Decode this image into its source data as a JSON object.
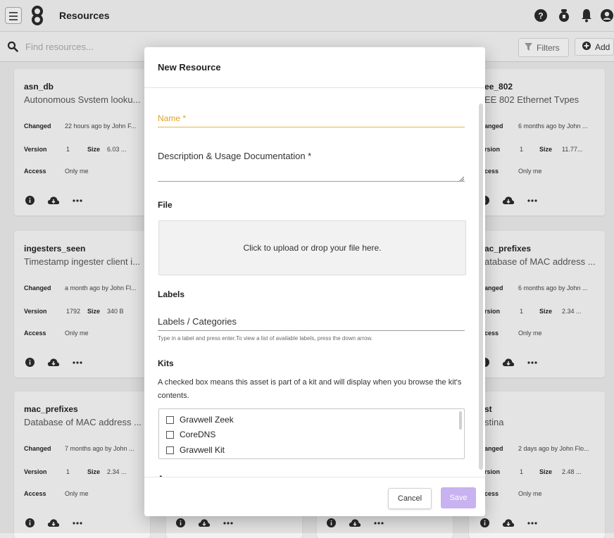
{
  "app": {
    "title": "Resources"
  },
  "search": {
    "placeholder": "Find resources..."
  },
  "toolbar": {
    "filters_label": "Filters",
    "add_label": "Add"
  },
  "cards": [
    {
      "name": "asn_db",
      "desc": "Autonomous Svstem looku...",
      "changed_label": "Changed",
      "changed": "22 hours ago by John F...",
      "version_label": "Version",
      "version": "1",
      "size_label": "Size",
      "size": "6.03 ...",
      "access_label": "Access",
      "access": "Only me"
    },
    {
      "name": "ee_802",
      "desc": "EE 802 Ethernet Tvpes",
      "changed_label": "anged",
      "changed": "6 months ago by John ...",
      "version_label": "rsion",
      "version": "1",
      "size_label": "Size",
      "size": "11.77...",
      "access_label": "cess",
      "access": "Only me"
    },
    {
      "name": "ingesters_seen",
      "desc": "Timestamp ingester client i...",
      "changed_label": "Changed",
      "changed": "a month ago by John Fl...",
      "version_label": "Version",
      "version": "1792",
      "size_label": "Size",
      "size": "340 B",
      "access_label": "Access",
      "access": "Only me"
    },
    {
      "name": "ac_prefixes",
      "desc": "atabase of MAC address ...",
      "changed_label": "anged",
      "changed": "6 months ago by John ...",
      "version_label": "rsion",
      "version": "1",
      "size_label": "Size",
      "size": "2.34 ...",
      "access_label": "cess",
      "access": "Only me"
    },
    {
      "name": "mac_prefixes",
      "desc": "Database of MAC address ...",
      "changed_label": "Changed",
      "changed": "7 months ago by John ...",
      "version_label": "Version",
      "version": "1",
      "size_label": "Size",
      "size": "2.34 ...",
      "access_label": "Access",
      "access": "Only me"
    },
    {
      "name": "st",
      "desc": "stina",
      "changed_label": "anged",
      "changed": "2 days ago by John Flo...",
      "version_label": "rsion",
      "version": "1",
      "size_label": "Size",
      "size": "2.48 ...",
      "access_label": "cess",
      "access": "Only me"
    }
  ],
  "modal": {
    "title": "New Resource",
    "name_label": "Name *",
    "desc_label": "Description & Usage Documentation *",
    "file_heading": "File",
    "dropzone_text": "Click to upload or drop your file here.",
    "labels_heading": "Labels",
    "labels_placeholder": "Labels / Categories",
    "labels_help": "Type in a label and press enter.To view a list of available labels, press the down arrow.",
    "kits_heading": "Kits",
    "kits_desc": "A checked box means this asset is part of a kit and will display when you browse the kit's contents.",
    "kits": [
      "Gravwell Zeek",
      "CoreDNS",
      "Gravwell Kit"
    ],
    "cut_heading": "A",
    "cancel_label": "Cancel",
    "save_label": "Save"
  },
  "colors": {
    "accent_purple": "#c8b2f0",
    "required_field": "#e0a32c"
  }
}
